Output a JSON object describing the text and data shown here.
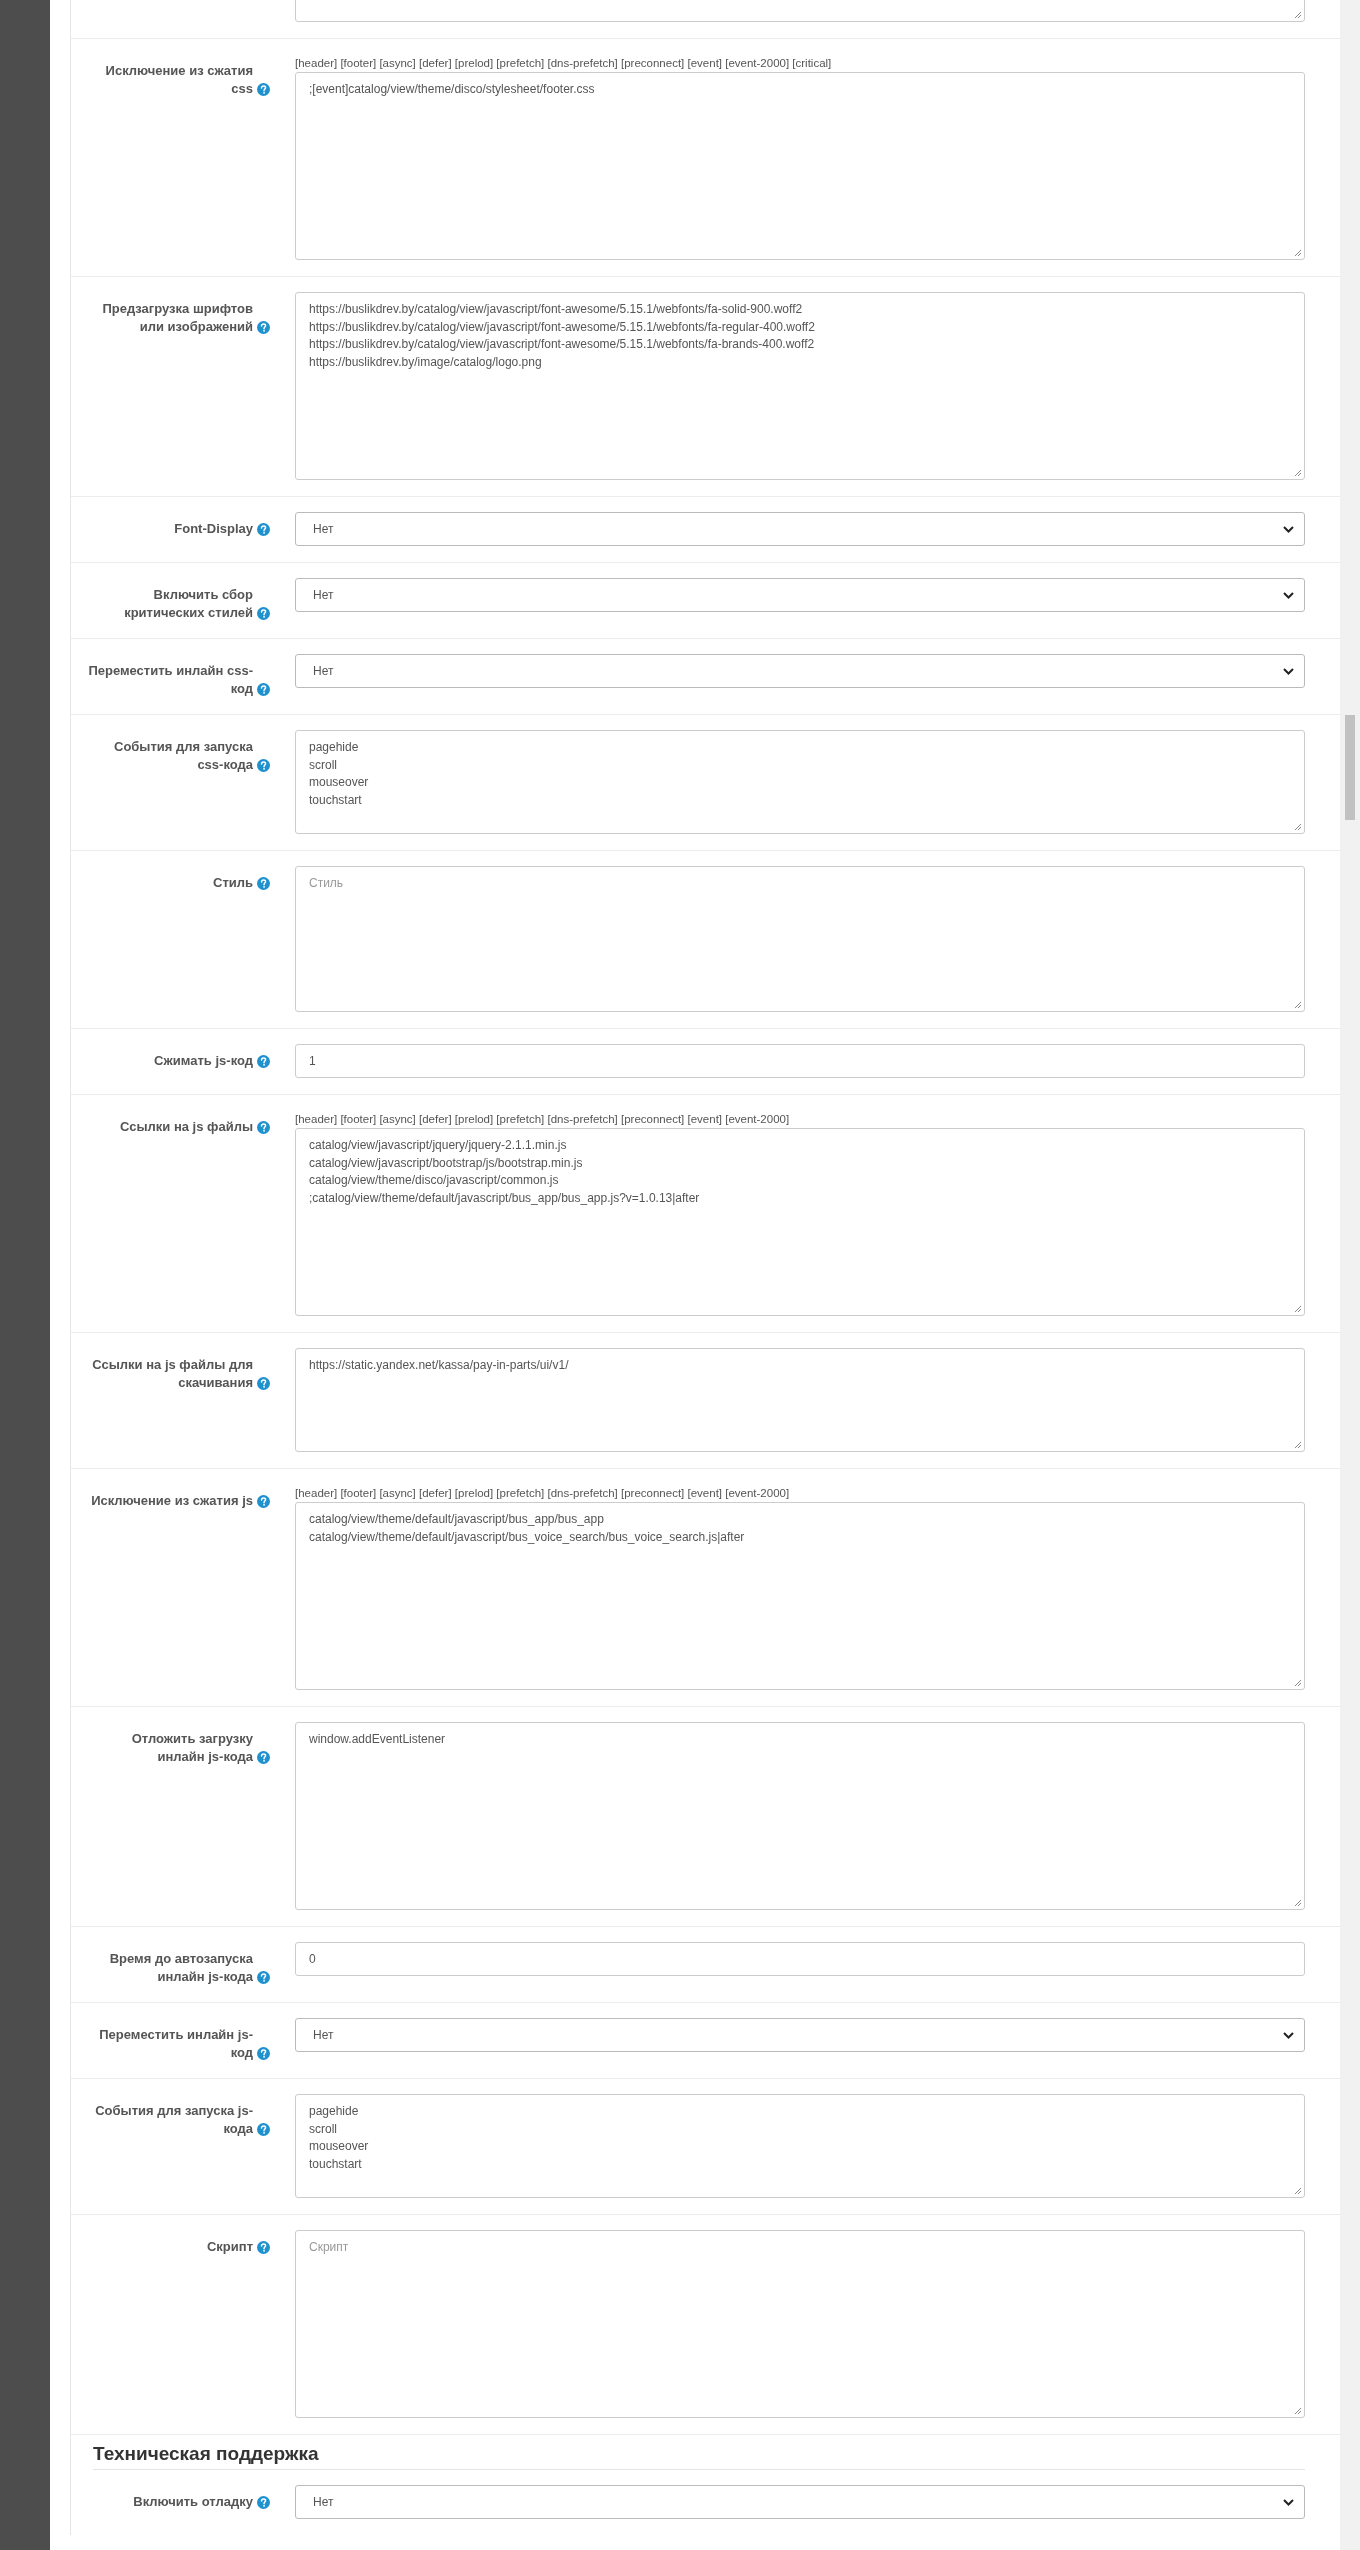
{
  "partial_field": {
    "kind": "textarea"
  },
  "sections": [
    {
      "fields": [
        {
          "label": "Исключение из сжатия css",
          "kind": "textarea",
          "hint": "[header] [footer] [async] [defer] [prelod] [prefetch] [dns-prefetch] [preconnect] [event] [event-2000] [critical]",
          "value": ";[event]catalog/view/theme/disco/stylesheet/footer.css"
        },
        {
          "label": "Предзагрузка шрифтов или изображений",
          "kind": "textarea",
          "value": "https://buslikdrev.by/catalog/view/javascript/font-awesome/5.15.1/webfonts/fa-solid-900.woff2\nhttps://buslikdrev.by/catalog/view/javascript/font-awesome/5.15.1/webfonts/fa-regular-400.woff2\nhttps://buslikdrev.by/catalog/view/javascript/font-awesome/5.15.1/webfonts/fa-brands-400.woff2\nhttps://buslikdrev.by/image/catalog/logo.png"
        },
        {
          "label": "Font-Display",
          "kind": "select",
          "value": "Нет"
        },
        {
          "label": "Включить сбор критических стилей",
          "kind": "select",
          "value": "Нет"
        },
        {
          "label": "Переместить инлайн css-код",
          "kind": "select",
          "value": "Нет"
        },
        {
          "label": "События для запуска css-кода",
          "kind": "textarea",
          "value": "pagehide\nscroll\nmouseover\ntouchstart"
        },
        {
          "label": "Стиль",
          "kind": "textarea",
          "placeholder": "Стиль"
        },
        {
          "label": "Сжимать js-код",
          "kind": "input",
          "value": "1"
        },
        {
          "label": "Ссылки на js файлы",
          "kind": "textarea",
          "hint": "[header] [footer] [async] [defer] [prelod] [prefetch] [dns-prefetch] [preconnect] [event] [event-2000]",
          "value": "catalog/view/javascript/jquery/jquery-2.1.1.min.js\ncatalog/view/javascript/bootstrap/js/bootstrap.min.js\ncatalog/view/theme/disco/javascript/common.js\n;catalog/view/theme/default/javascript/bus_app/bus_app.js?v=1.0.13|after"
        },
        {
          "label": "Ссылки на js файлы для скачивания",
          "kind": "textarea",
          "value": "https://static.yandex.net/kassa/pay-in-parts/ui/v1/"
        },
        {
          "label": "Исключение из сжатия js",
          "kind": "textarea",
          "hint": "[header] [footer] [async] [defer] [prelod] [prefetch] [dns-prefetch] [preconnect] [event] [event-2000]",
          "value": "catalog/view/theme/default/javascript/bus_app/bus_app\ncatalog/view/theme/default/javascript/bus_voice_search/bus_voice_search.js|after"
        },
        {
          "label": "Отложить загрузку инлайн js-кода",
          "kind": "textarea",
          "value": "window.addEventListener"
        },
        {
          "label": "Время до автозапуска инлайн js-кода",
          "kind": "input",
          "value": "0"
        },
        {
          "label": "Переместить инлайн js-код",
          "kind": "select",
          "value": "Нет"
        },
        {
          "label": "События для запуска js-кода",
          "kind": "textarea",
          "value": "pagehide\nscroll\nmouseover\ntouchstart"
        },
        {
          "label": "Скрипт",
          "kind": "textarea",
          "placeholder": "Скрипт"
        }
      ]
    },
    {
      "heading": "Техническая поддержка",
      "fields": [
        {
          "label": "Включить отладку",
          "kind": "select",
          "value": "Нет"
        }
      ]
    }
  ]
}
